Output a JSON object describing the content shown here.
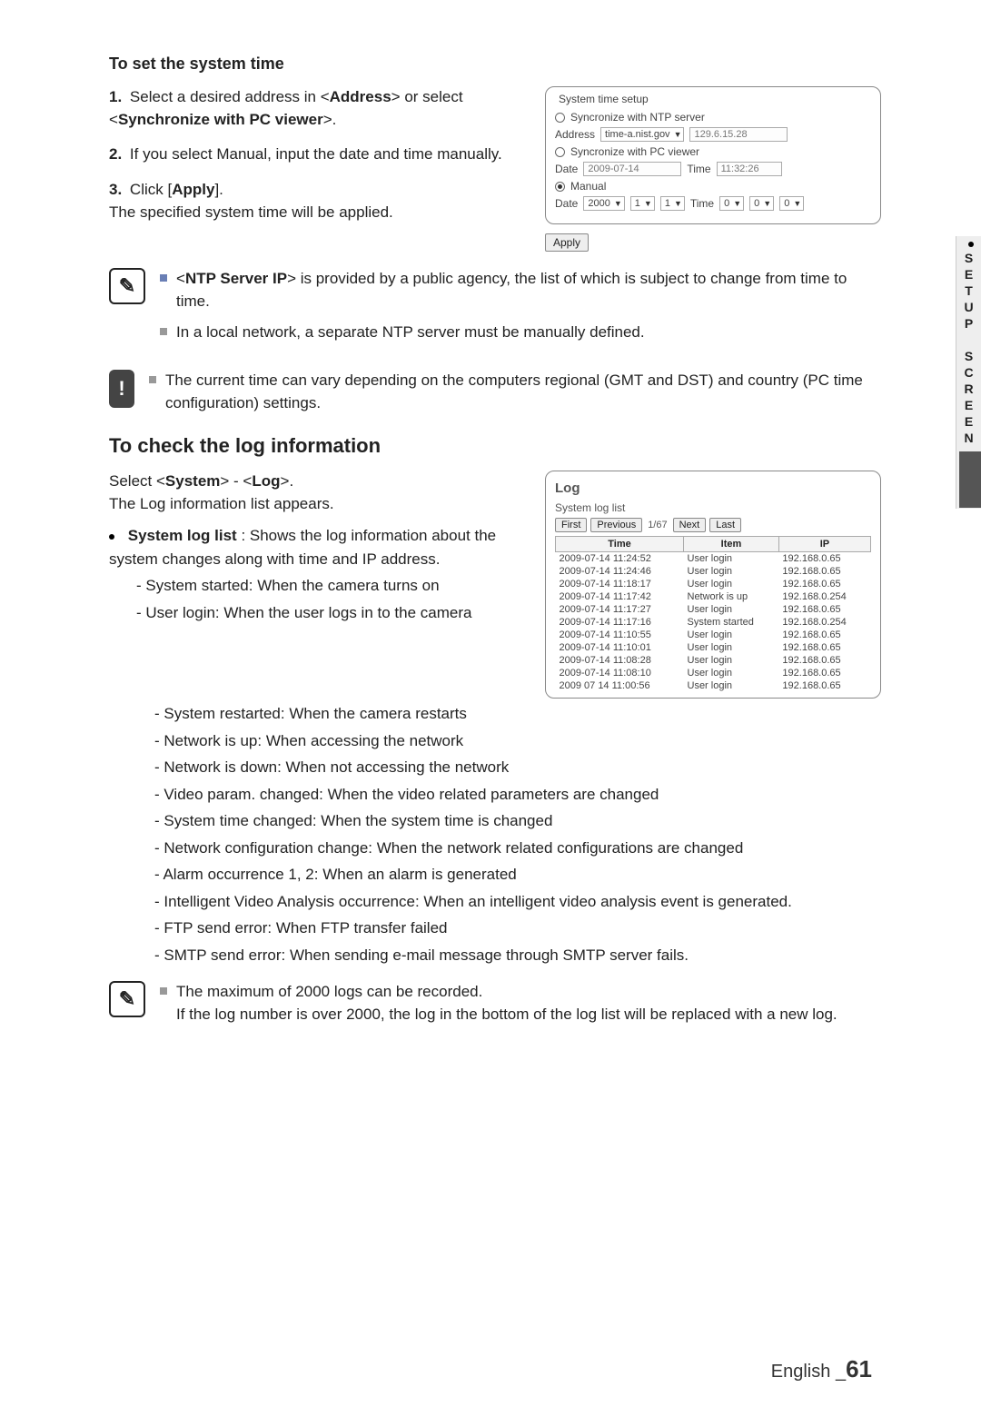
{
  "sideTab": "SETUP SCREEN",
  "section1": {
    "title": "To set the system time",
    "steps": [
      {
        "num": "1.",
        "pre": "Select a desired address in <",
        "b1": "Address",
        "mid": "> or select <",
        "b2": "Synchronize with PC viewer",
        "post": ">."
      },
      {
        "num": "2.",
        "text": "If you select Manual, input the date and time manually."
      },
      {
        "num": "3.",
        "pre": "Click [",
        "b1": "Apply",
        "post": "].",
        "tail": "The specified system time will be applied."
      }
    ],
    "panel": {
      "legend": "System time setup",
      "opt1": "Syncronize with NTP server",
      "addrLabel": "Address",
      "addrValue": "time-a.nist.gov",
      "addrIp": "129.6.15.28",
      "opt2": "Syncronize with PC viewer",
      "dateLabel": "Date",
      "dateValue": "2009-07-14",
      "timeLabel": "Time",
      "timeValue": "11:32:26",
      "opt3": "Manual",
      "manual": {
        "year": "2000",
        "m": "1",
        "d": "1",
        "h": "0",
        "mi": "0",
        "s": "0"
      },
      "apply": "Apply"
    },
    "notes": [
      {
        "pre": "<",
        "b": "NTP Server IP",
        "post": "> is provided by a public agency, the list of which is subject to change from time to time."
      },
      {
        "text": "In a local network, a separate NTP server must be manually defined."
      }
    ],
    "warn": "The current time can vary depending on the computers regional (GMT and DST) and country (PC time configuration) settings."
  },
  "section2": {
    "title": "To check the log information",
    "introPre": "Select <",
    "introB1": "System",
    "introMid": "> - <",
    "introB2": "Log",
    "introPost": ">.",
    "introTail": "The Log information list appears.",
    "bulletHeadB": "System log list",
    "bulletHeadRest": " : Shows the log information about the system changes along with time and IP address.",
    "dashesTop": [
      "System started: When the camera turns on",
      "User login: When the user logs in to the camera"
    ],
    "dashesFull": [
      "System restarted: When the camera restarts",
      "Network is up: When accessing the network",
      "Network is down: When not accessing the network",
      "Video param. changed: When the video related parameters are changed",
      "System time changed: When the system time is changed",
      "Network configuration change: When the network related configurations are changed",
      "Alarm occurrence 1, 2: When an alarm is generated",
      "Intelligent Video Analysis occurrence: When an intelligent video analysis event is generated.",
      "FTP send error: When FTP transfer failed",
      "SMTP send error: When sending e-mail message through SMTP server fails."
    ],
    "logPanel": {
      "title": "Log",
      "listLabel": "System log list",
      "first": "First",
      "prev": "Previous",
      "page": "1/67",
      "next": "Next",
      "last": "Last",
      "cols": {
        "time": "Time",
        "item": "Item",
        "ip": "IP"
      },
      "rows": [
        {
          "t": "2009-07-14 11:24:52",
          "i": "User login",
          "ip": "192.168.0.65"
        },
        {
          "t": "2009-07-14 11:24:46",
          "i": "User login",
          "ip": "192.168.0.65"
        },
        {
          "t": "2009-07-14 11:18:17",
          "i": "User login",
          "ip": "192.168.0.65"
        },
        {
          "t": "2009-07-14 11:17:42",
          "i": "Network is up",
          "ip": "192.168.0.254"
        },
        {
          "t": "2009-07-14 11:17:27",
          "i": "User login",
          "ip": "192.168.0.65"
        },
        {
          "t": "2009-07-14 11:17:16",
          "i": "System started",
          "ip": "192.168.0.254"
        },
        {
          "t": "2009-07-14 11:10:55",
          "i": "User login",
          "ip": "192.168.0.65"
        },
        {
          "t": "2009-07-14 11:10:01",
          "i": "User login",
          "ip": "192.168.0.65"
        },
        {
          "t": "2009-07-14 11:08:28",
          "i": "User login",
          "ip": "192.168.0.65"
        },
        {
          "t": "2009-07-14 11:08:10",
          "i": "User login",
          "ip": "192.168.0.65"
        },
        {
          "t": "2009 07 14 11:00:56",
          "i": "User login",
          "ip": "192.168.0.65"
        }
      ]
    },
    "note2a": "The maximum of 2000 logs can be recorded.",
    "note2b": "If the log number is over 2000, the log in the bottom of the log list will be replaced with a new log."
  },
  "footer": {
    "lang": "English",
    "sep": "_",
    "page": "61"
  }
}
